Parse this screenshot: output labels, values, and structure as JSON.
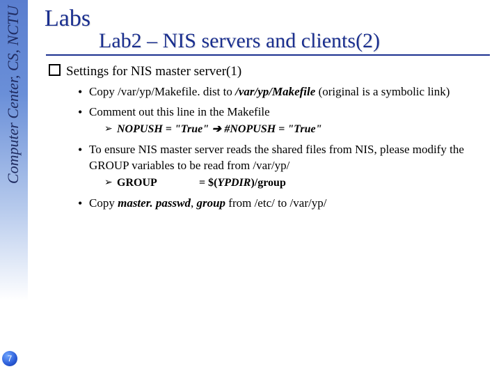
{
  "page_number": "7",
  "sidebar_text": "Computer Center, CS, NCTU",
  "title_main": "Labs",
  "title_sub_prefix": "Lab2 ",
  "title_sub_dash": "–",
  "title_sub_rest": " NIS servers and clients(2)",
  "heading": "Settings for NIS master server(1)",
  "bullets": {
    "b1_a": "Copy /var/yp/Makefile. dist to ",
    "b1_b": "/var/yp/Makefile",
    "b1_c": " (original is a symbolic link)",
    "b2": "Comment out this line in the Makefile",
    "b2s_a": "NOPUSH = \"True\"",
    "b2s_arrow": " ➔ ",
    "b2s_b": "#NOPUSH = \"True\"",
    "b3": "To ensure NIS master server reads the shared files from NIS, please modify the GROUP variables to be read from /var/yp/",
    "b3s_label": "GROUP",
    "b3s_val_a": "= $(",
    "b3s_val_b": "YPDIR",
    "b3s_val_c": ")/group",
    "b4_a": "Copy ",
    "b4_b": "master. passwd",
    "b4_c": ", ",
    "b4_d": "group",
    "b4_e": " from /etc/ to /var/yp/"
  }
}
